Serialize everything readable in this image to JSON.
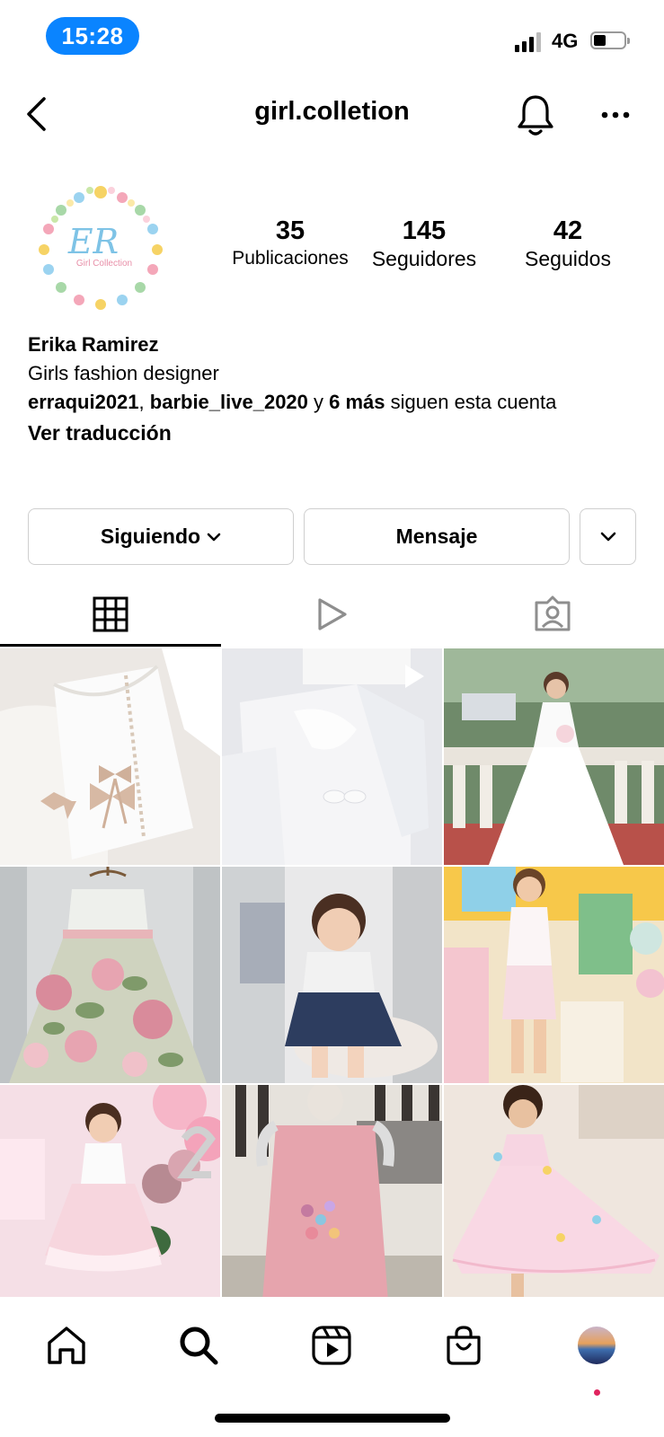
{
  "status_bar": {
    "time": "15:28",
    "network": "4G"
  },
  "header": {
    "username": "girl.colletion"
  },
  "profile": {
    "logo_text": "Girl Collection",
    "logo_monogram": "ER",
    "stats": [
      {
        "value": "35",
        "label": "Publicaciones"
      },
      {
        "value": "145",
        "label": "Seguidores"
      },
      {
        "value": "42",
        "label": "Seguidos"
      }
    ],
    "name": "Erika Ramirez",
    "bio": "Girls fashion designer",
    "followed_by": {
      "user1": "erraqui2021",
      "sep": ", ",
      "user2": "barbie_live_2020",
      "and": " y ",
      "more": "6 más",
      "suffix": " siguen esta cuenta"
    },
    "translate": "Ver traducción"
  },
  "actions": {
    "following": "Siguiendo",
    "message": "Mensaje"
  },
  "tabs": [
    "grid-icon",
    "reels-icon",
    "tagged-icon"
  ],
  "posts": [
    {
      "desc": "white dress with ruffles and beige bows",
      "reel": true
    },
    {
      "desc": "white boy christening outfit",
      "reel": true
    },
    {
      "desc": "girl in white communion dress",
      "reel": false
    },
    {
      "desc": "floral dress on hanger",
      "reel": false
    },
    {
      "desc": "toddler in navy pinafore",
      "reel": false
    },
    {
      "desc": "girl in pink romper",
      "reel": false
    },
    {
      "desc": "toddler in pink tutu dress",
      "reel": false
    },
    {
      "desc": "pink dress on mannequin",
      "reel": false
    },
    {
      "desc": "girl in light pink party dress",
      "reel": false
    }
  ],
  "colors": {
    "accent": "#0a84ff",
    "border": "#cfcfcf",
    "notification_dot": "#e0245e"
  }
}
